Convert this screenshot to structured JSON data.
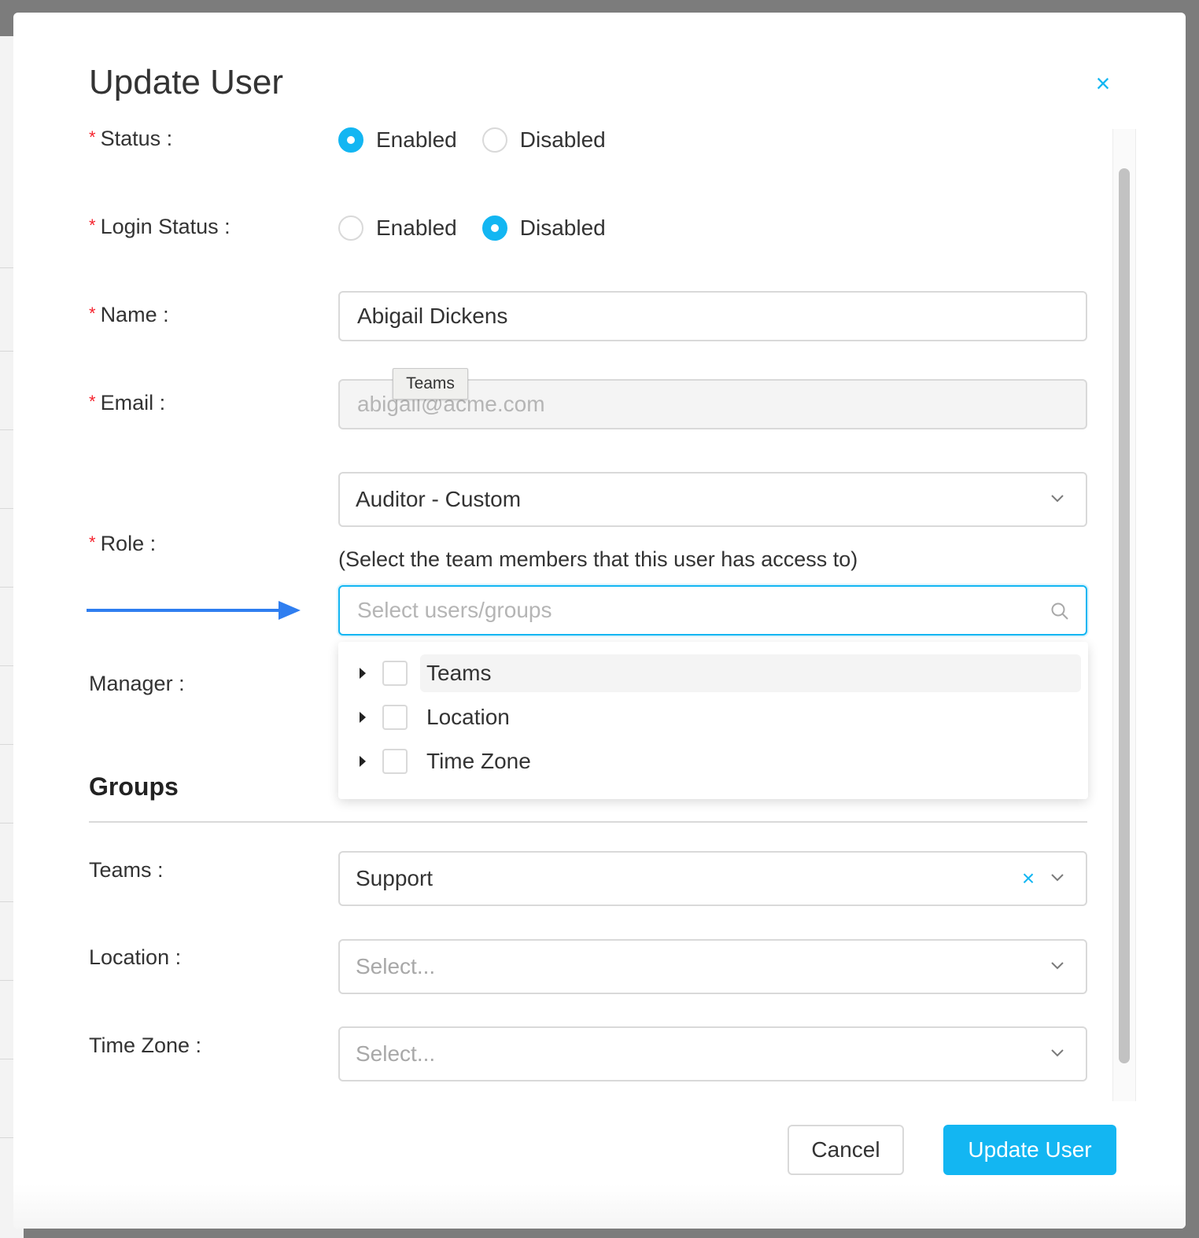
{
  "modal": {
    "title": "Update User",
    "close_glyph": "×"
  },
  "form": {
    "status": {
      "label": "Status",
      "options": [
        "Enabled",
        "Disabled"
      ],
      "selected": "Enabled"
    },
    "login_status": {
      "label": "Login Status",
      "options": [
        "Enabled",
        "Disabled"
      ],
      "selected": "Disabled"
    },
    "name": {
      "label": "Name",
      "value": "Abigail Dickens"
    },
    "email": {
      "label": "Email",
      "value": "abigail@acme.com"
    },
    "role": {
      "label": "Role",
      "value": "Auditor - Custom",
      "hint": "(Select the team members that this user has access to)",
      "search_placeholder": "Select users/groups"
    },
    "manager": {
      "label": "Manager"
    }
  },
  "tree_dropdown": {
    "items": [
      {
        "label": "Teams",
        "hovered": true
      },
      {
        "label": "Location",
        "hovered": false
      },
      {
        "label": "Time Zone",
        "hovered": false
      }
    ]
  },
  "tooltip": {
    "text": "Teams"
  },
  "groups": {
    "title": "Groups",
    "teams": {
      "label": "Teams",
      "value": "Support"
    },
    "location": {
      "label": "Location",
      "placeholder": "Select..."
    },
    "time_zone": {
      "label": "Time Zone",
      "placeholder": "Select..."
    }
  },
  "footer": {
    "cancel_label": "Cancel",
    "submit_label": "Update User"
  },
  "colors": {
    "accent": "#13b6f2",
    "required": "#f5222d",
    "arrow": "#2f7ef0"
  },
  "icons": [
    "close-icon",
    "chevron-down-icon",
    "search-icon",
    "caret-right-icon",
    "clear-icon",
    "arrow-right-icon"
  ]
}
